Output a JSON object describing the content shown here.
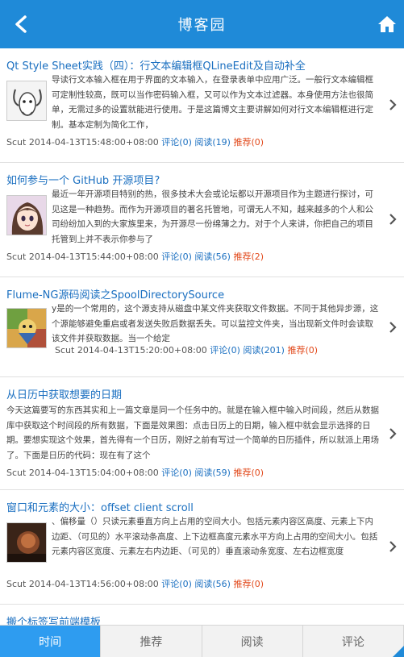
{
  "header": {
    "title": "博客园",
    "back_icon": "back-arrow-icon",
    "home_icon": "home-icon"
  },
  "colors": {
    "accent": "#1f8ad8",
    "link": "#1a6fc0",
    "recommend": "#e24a1c",
    "active_tab": "#2e9cf0"
  },
  "posts": [
    {
      "title": "Qt Style Sheet实践（四）：行文本编辑框QLineEdit及自动补全",
      "summary": "导读行文本输入框在用于界面的文本输入，在登录表单中应用广泛。一般行文本编辑框可定制性较高，既可以当作密码输入框，又可以作为文本过滤器。本身使用方法也很简单，无需过多的设置就能进行使用。于是这篇博文主要讲解如何对行文本编辑框进行定制。基本定制为简化工作，",
      "author": "Scut",
      "time": "2014-04-13T15:48:00+08:00",
      "comments": "评论(0)",
      "reads": "阅读(19)",
      "recommend": "推荐(0)",
      "thumb": "gnu-logo-thumb"
    },
    {
      "title": "如何参与一个 GitHub 开源项目?",
      "summary": "最近一年开源项目特别的热，很多技术大会或论坛都以开源项目作为主题进行探讨，可见这是一种趋势。而作为开源项目的著名托管地，可谓无人不知，越来越多的个人和公司纷纷加入到的大家族里来，为开源尽一份绵薄之力。对于个人来讲，你把自己的项目托管到上并不表示你参与了",
      "author": "Scut",
      "time": "2014-04-13T15:44:00+08:00",
      "comments": "评论(0)",
      "reads": "阅读(56)",
      "recommend": "推荐(2)",
      "thumb": "anime-avatar-thumb"
    },
    {
      "title": "Flume-NG源码阅读之SpoolDirectorySource",
      "summary": "y是的一个常用的，这个源支持从磁盘中某文件夹获取文件数据。不同于其他异步源，这个源能够避免重启或者发送失败后数据丢失。可以监控文件夹，当出现新文件时会读取该文件并获取数据。当一个给定",
      "author": "Scut",
      "time": "2014-04-13T15:20:00+08:00",
      "comments": "评论(0)",
      "reads": "阅读(201)",
      "recommend": "推荐(0)",
      "thumb": "colorful-avatar-thumb"
    },
    {
      "title": "从日历中获取想要的日期",
      "summary": "今天这篇要写的东西其实和上一篇文章是同一个任务中的。就是在输入框中输入时间段，然后从数据库中获取这个时间段的所有数据，下面是效果图：点击日历上的日期，输入框中就会显示选择的日期。要想实现这个效果，首先得有一个日历，刚好之前有写过一个简单的日历插件，所以就派上用场了。下面是日历的代码：现在有了这个",
      "author": "Scut",
      "time": "2014-04-13T15:04:00+08:00",
      "comments": "评论(0)",
      "reads": "阅读(59)",
      "recommend": "推荐(0)",
      "thumb": ""
    },
    {
      "title": "窗口和元素的大小：offset client scroll",
      "summary": "、偏移量（）只读元素垂直方向上占用的空间大小。包括元素内容区高度、元素上下内边距、（可见的）水平滚动条高度、上下边框高度元素水平方向上占用的空间大小。包括元素内容区宽度、元素左右内边距、（可见的）垂直滚动条宽度、左右边框宽度",
      "author": "Scut",
      "time": "2014-04-13T14:56:00+08:00",
      "comments": "评论(0)",
      "reads": "阅读(56)",
      "recommend": "推荐(0)",
      "thumb": "dark-photo-thumb"
    },
    {
      "title": "搬个标签写前端模板",
      "summary": "",
      "author": "",
      "time": "",
      "comments": "",
      "reads": "",
      "recommend": "",
      "thumb": ""
    }
  ],
  "tabs": [
    {
      "label": "时间",
      "active": true
    },
    {
      "label": "推荐",
      "active": false
    },
    {
      "label": "阅读",
      "active": false
    },
    {
      "label": "评论",
      "active": false
    }
  ]
}
